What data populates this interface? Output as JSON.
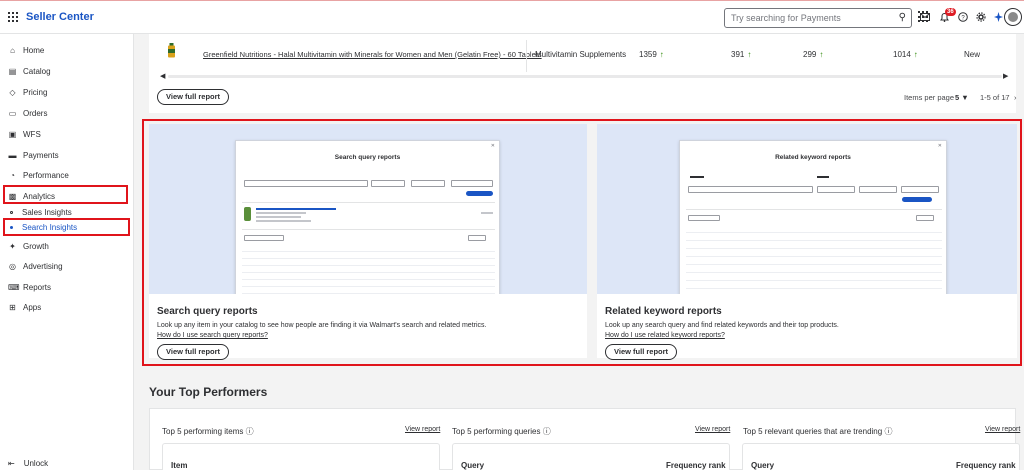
{
  "app": {
    "brand": "Seller Center",
    "search_placeholder": "Try searching for Payments",
    "notification_count": "36"
  },
  "sidebar": {
    "items": [
      {
        "label": "Home",
        "icon": "home-icon"
      },
      {
        "label": "Catalog",
        "icon": "catalog-icon"
      },
      {
        "label": "Pricing",
        "icon": "tag-icon"
      },
      {
        "label": "Orders",
        "icon": "orders-icon"
      },
      {
        "label": "WFS",
        "icon": "box-icon"
      },
      {
        "label": "Payments",
        "icon": "payments-icon"
      },
      {
        "label": "Performance",
        "icon": "gauge-icon"
      },
      {
        "label": "Analytics",
        "icon": "analytics-icon"
      },
      {
        "label": "Growth",
        "icon": "growth-icon"
      },
      {
        "label": "Advertising",
        "icon": "advertising-icon"
      },
      {
        "label": "Reports",
        "icon": "reports-icon"
      },
      {
        "label": "Apps",
        "icon": "apps-icon"
      }
    ],
    "sub_items": [
      "Sales Insights",
      "Search Insights"
    ],
    "unlock_label": "Unlock"
  },
  "top_table": {
    "product_name": "Greenfield Nutritions - Halal Multivitamin with Minerals for Women and Men (Gelatin Free) - 60 Tablets",
    "category": "Multivitamin Supplements",
    "v1": "1359",
    "v2": "391",
    "v3": "299",
    "v4": "1014",
    "status": "New",
    "view_full_report": "View full report",
    "items_per_page_label": "Items per page",
    "items_per_page_value": "5",
    "range": "1-5 of 17"
  },
  "panels": [
    {
      "mock_title": "Search query reports",
      "title": "Search query reports",
      "description": "Look up any item in your catalog to see how people are finding it via Walmart's search and related metrics.",
      "link": "How do I use search query reports?",
      "button": "View full report"
    },
    {
      "mock_title": "Related keyword reports",
      "title": "Related keyword reports",
      "description": "Look up any search query and find related keywords and their top products.",
      "link": "How do I use related keyword reports?",
      "button": "View full report"
    }
  ],
  "top_performers": {
    "title": "Your Top Performers",
    "sections": [
      {
        "heading": "Top 5 performing items",
        "link": "View report",
        "col1": "Item",
        "col2": ""
      },
      {
        "heading": "Top 5 performing queries",
        "link": "View report",
        "col1": "Query",
        "col2": "Frequency rank"
      },
      {
        "heading": "Top 5 relevant queries that are trending",
        "link": "View report",
        "col1": "Query",
        "col2": "Frequency rank"
      }
    ]
  }
}
